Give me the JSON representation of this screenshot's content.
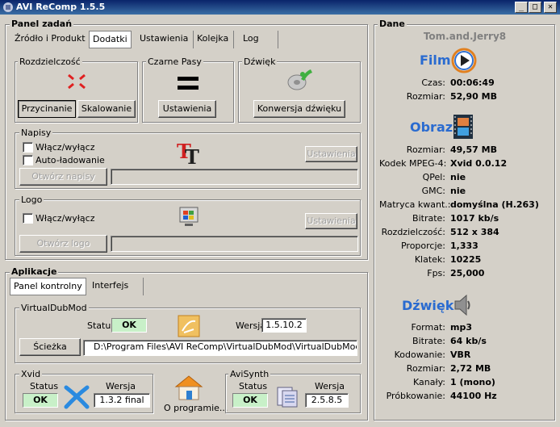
{
  "window": {
    "title": "AVI ReComp  1.5.5",
    "min": "_",
    "max": "□",
    "close": "✕"
  },
  "panel": {
    "title": "Panel zadań",
    "tabs": [
      "Źródło i Produkt",
      "Dodatki",
      "Ustawienia",
      "Kolejka",
      "Log"
    ],
    "active_tab": "Dodatki"
  },
  "resolution": {
    "title": "Rozdzielczość",
    "crop": "Przycinanie",
    "scale": "Skalowanie"
  },
  "borders": {
    "title": "Czarne Pasy",
    "settings": "Ustawienia"
  },
  "sound": {
    "title": "Dźwięk",
    "convert": "Konwersja dźwięku"
  },
  "subs": {
    "title": "Napisy",
    "toggle": "Włącz/wyłącz",
    "autoload": "Auto-ładowanie",
    "settings": "Ustawienia",
    "open": "Otwórz napisy",
    "path": ""
  },
  "logo": {
    "title": "Logo",
    "toggle": "Włącz/wyłącz",
    "settings": "Ustawienia",
    "open": "Otwórz logo",
    "path": ""
  },
  "app": {
    "title": "Aplikacje",
    "tabs": [
      "Panel kontrolny",
      "Interfejs"
    ],
    "vdm": {
      "title": "VirtualDubMod",
      "status_label": "Status",
      "status": "OK",
      "version_label": "Wersja",
      "version": "1.5.10.2",
      "path_btn": "Ścieżka",
      "path": "D:\\Program Files\\AVI ReComp\\VirtualDubMod\\VirtualDubMod.exe"
    },
    "xvid": {
      "title": "Xvid",
      "status_label": "Status",
      "status": "OK",
      "version_label": "Wersja",
      "version": "1.3.2 final"
    },
    "about": "O programie...",
    "avisynth": {
      "title": "AviSynth",
      "status_label": "Status",
      "status": "OK",
      "version_label": "Wersja",
      "version": "2.5.8.5"
    }
  },
  "dane": {
    "title": "Dane",
    "filename": "Tom.and.Jerry8",
    "film": {
      "heading": "Film",
      "rows": [
        [
          "Czas:",
          "00:06:49"
        ],
        [
          "Rozmiar:",
          "52,90 MB"
        ]
      ]
    },
    "obraz": {
      "heading": "Obraz",
      "rows": [
        [
          "Rozmiar:",
          "49,57 MB"
        ],
        [
          "Kodek MPEG-4:",
          "Xvid 0.0.12"
        ],
        [
          "QPel:",
          "nie"
        ],
        [
          "GMC:",
          "nie"
        ],
        [
          "Matryca kwant.:",
          "domyślna (H.263)"
        ],
        [
          "Bitrate:",
          "1017 kb/s"
        ],
        [
          "Rozdzielczość:",
          "512 x 384"
        ],
        [
          "Proporcje:",
          "1,333"
        ],
        [
          "Klatek:",
          "10225"
        ],
        [
          "Fps:",
          "25,000"
        ]
      ]
    },
    "dzwiek": {
      "heading": "Dźwięk",
      "rows": [
        [
          "Format:",
          "mp3"
        ],
        [
          "Bitrate:",
          "64 kb/s"
        ],
        [
          "Kodowanie:",
          "VBR"
        ],
        [
          "Rozmiar:",
          "2,72 MB"
        ],
        [
          "Kanały:",
          "1 (mono)"
        ],
        [
          "Próbkowanie:",
          "44100 Hz"
        ]
      ]
    }
  }
}
